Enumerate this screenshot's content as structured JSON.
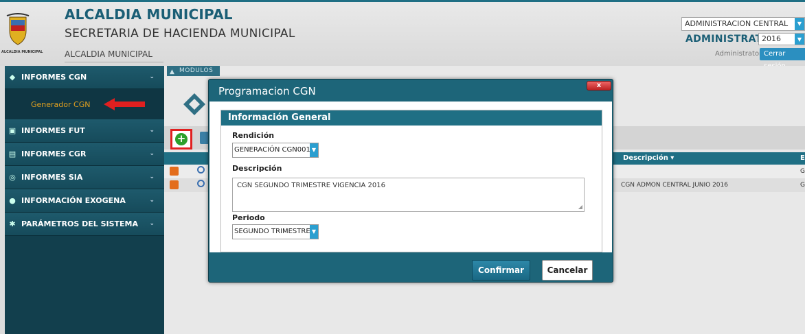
{
  "header": {
    "title": "ALCALDIA MUNICIPAL",
    "subtitle": "SECRETARIA DE HACIENDA MUNICIPAL",
    "subtitle2": "ALCALDIA MUNICIPAL",
    "logo_text": "ALCALDIA MUNICIPAL",
    "entity_select": "ADMINISTRACION CENTRAL",
    "administrator_label": "ADMINISTRATOR",
    "year_select": "2016",
    "user_name": "Administrator",
    "logout_label": "Cerrar sesión"
  },
  "sidebar": {
    "items": [
      {
        "label": "INFORMES CGN",
        "icon": "report-icon"
      },
      {
        "label": "INFORMES FUT",
        "icon": "report-icon"
      },
      {
        "label": "INFORMES CGR",
        "icon": "report-icon"
      },
      {
        "label": "INFORMES SIA",
        "icon": "search-report-icon"
      },
      {
        "label": "INFORMACIÓN EXOGENA",
        "icon": "globe-icon"
      },
      {
        "label": "PARÁMETROS DEL SISTEMA",
        "icon": "gear-icon"
      }
    ],
    "sub_item": "Generador CGN"
  },
  "content": {
    "modulos_tab": "MODULOS",
    "column_description": "Descripción",
    "column_e": "E",
    "rows": [
      {
        "description": "",
        "e": "G"
      },
      {
        "description": "CGN ADMON CENTRAL JUNIO 2016",
        "e": "G"
      }
    ]
  },
  "modal": {
    "title": "Programacion CGN",
    "close_label": "x",
    "section_title": "Información General",
    "rendicion_label": "Rendición",
    "rendicion_value": "GENERACIÓN CGN001",
    "descripcion_label": "Descripción",
    "descripcion_value": "CGN SEGUNDO TRIMESTRE VIGENCIA 2016",
    "periodo_label": "Periodo",
    "periodo_value": "SEGUNDO TRIMESTRE",
    "confirm_label": "Confirmar",
    "cancel_label": "Cancelar"
  },
  "colors": {
    "primary": "#1f6f84",
    "sidebar": "#123f4d",
    "accent_orange": "#e0a020",
    "highlight_red": "#e02020"
  }
}
